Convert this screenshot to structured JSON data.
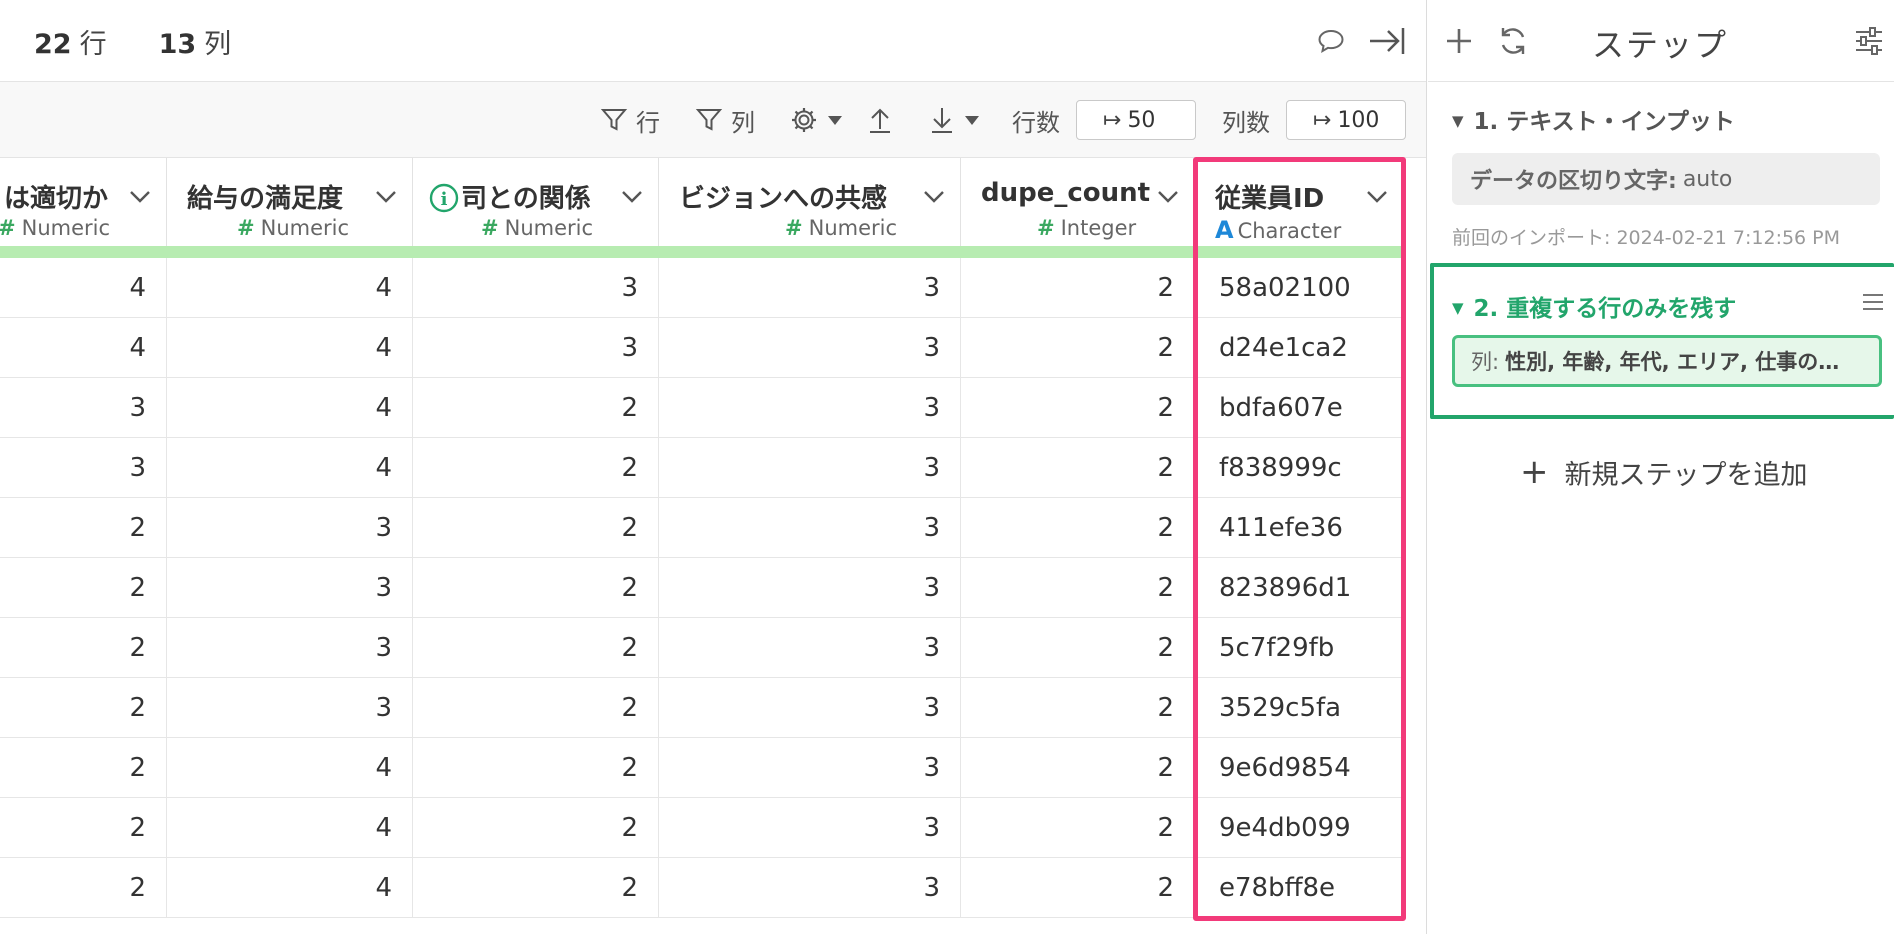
{
  "topbar": {
    "row_count": "22",
    "row_unit": "行",
    "col_count": "13",
    "col_unit": "列",
    "icons": [
      "comment-icon",
      "collapse-right-icon"
    ]
  },
  "toolbar": {
    "row_filter_label": "行",
    "col_filter_label": "列",
    "rows_label": "行数",
    "rows_value": "50",
    "cols_label": "列数",
    "cols_value": "100",
    "icons": [
      "filter-icon",
      "gear-icon",
      "upload-icon",
      "download-icon"
    ]
  },
  "columns": [
    {
      "name": "は適切か",
      "type": "Numeric",
      "type_icon": "#"
    },
    {
      "name": "給与の満足度",
      "type": "Numeric",
      "type_icon": "#"
    },
    {
      "name": "司との関係",
      "type": "Numeric",
      "type_icon": "#",
      "has_info_icon": true
    },
    {
      "name": "ビジョンへの共感",
      "type": "Numeric",
      "type_icon": "#"
    },
    {
      "name": "dupe_count",
      "type": "Integer",
      "type_icon": "#"
    },
    {
      "name": "従業員ID",
      "type": "Character",
      "type_icon": "A"
    }
  ],
  "rows": [
    [
      "4",
      "4",
      "3",
      "3",
      "2",
      "58a02100"
    ],
    [
      "4",
      "4",
      "3",
      "3",
      "2",
      "d24e1ca2"
    ],
    [
      "3",
      "4",
      "2",
      "3",
      "2",
      "bdfa607e"
    ],
    [
      "3",
      "4",
      "2",
      "3",
      "2",
      "f838999c"
    ],
    [
      "2",
      "3",
      "2",
      "3",
      "2",
      "411efe36"
    ],
    [
      "2",
      "3",
      "2",
      "3",
      "2",
      "823896d1"
    ],
    [
      "2",
      "3",
      "2",
      "3",
      "2",
      "5c7f29fb"
    ],
    [
      "2",
      "3",
      "2",
      "3",
      "2",
      "3529c5fa"
    ],
    [
      "2",
      "4",
      "2",
      "3",
      "2",
      "9e6d9854"
    ],
    [
      "2",
      "4",
      "2",
      "3",
      "2",
      "9e4db099"
    ],
    [
      "2",
      "4",
      "2",
      "3",
      "2",
      "e78bff8e"
    ]
  ],
  "steps_panel": {
    "title": "ステップ",
    "steps": [
      {
        "title": "1. テキスト・インプット",
        "param_label": "データの区切り文字:",
        "param_value": "auto",
        "import_note": "前回のインポート: 2024-02-21 7:12:56 PM"
      },
      {
        "title": "2. 重複する行のみを残す",
        "param_label": "列:",
        "param_value": "性別, 年齢, 年代, エリア, 仕事の…"
      }
    ],
    "add_step_label": "新規ステップを追加"
  },
  "colors": {
    "highlight": "#f23a7a",
    "accent_green": "#22a56b",
    "numeric_hash": "#3aa860",
    "character_icon": "#1e88d8"
  }
}
